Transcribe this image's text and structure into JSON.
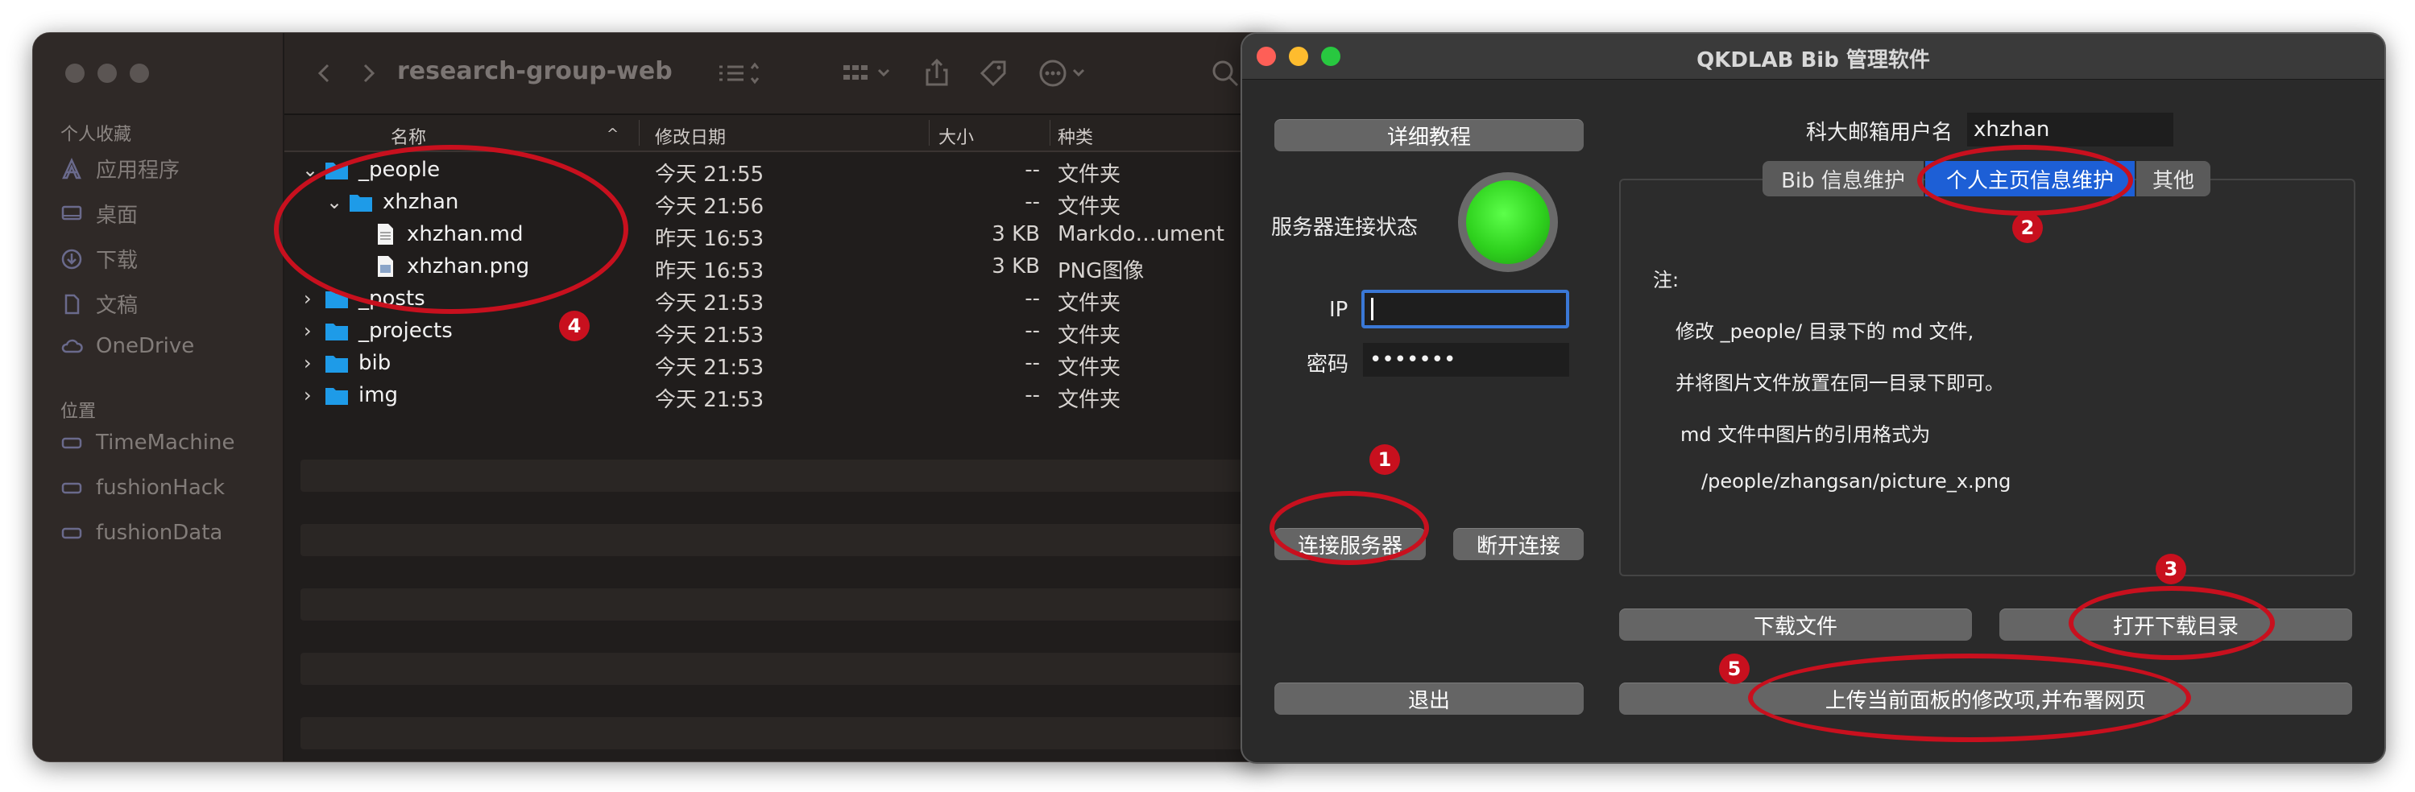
{
  "finder": {
    "title": "research-group-web",
    "sidebar": {
      "favorites_heading": "个人收藏",
      "favorites": [
        {
          "label": "应用程序",
          "icon": "applications-icon"
        },
        {
          "label": "桌面",
          "icon": "desktop-icon"
        },
        {
          "label": "下载",
          "icon": "downloads-icon"
        },
        {
          "label": "文稿",
          "icon": "documents-icon"
        },
        {
          "label": "OneDrive",
          "icon": "cloud-icon"
        }
      ],
      "locations_heading": "位置",
      "locations": [
        {
          "label": "TimeMachine",
          "icon": "disk-icon"
        },
        {
          "label": "fushionHack",
          "icon": "disk-icon"
        },
        {
          "label": "fushionData",
          "icon": "disk-icon"
        }
      ]
    },
    "columns": {
      "name": "名称",
      "modified": "修改日期",
      "size": "大小",
      "kind": "种类"
    },
    "rows": [
      {
        "name": "_people",
        "date": "今天 21:55",
        "size": "--",
        "kind": "文件夹",
        "type": "folder",
        "indent": 0,
        "disclosure": "open"
      },
      {
        "name": "xhzhan",
        "date": "今天 21:56",
        "size": "--",
        "kind": "文件夹",
        "type": "folder",
        "indent": 1,
        "disclosure": "open"
      },
      {
        "name": "xhzhan.md",
        "date": "昨天 16:53",
        "size": "3 KB",
        "kind": "Markdo…ument",
        "type": "file",
        "indent": 2,
        "disclosure": "none"
      },
      {
        "name": "xhzhan.png",
        "date": "昨天 16:53",
        "size": "3 KB",
        "kind": "PNG图像",
        "type": "image",
        "indent": 2,
        "disclosure": "none"
      },
      {
        "name": "_posts",
        "date": "今天 21:53",
        "size": "--",
        "kind": "文件夹",
        "type": "folder",
        "indent": 0,
        "disclosure": "closed"
      },
      {
        "name": "_projects",
        "date": "今天 21:53",
        "size": "--",
        "kind": "文件夹",
        "type": "folder",
        "indent": 0,
        "disclosure": "closed"
      },
      {
        "name": "bib",
        "date": "今天 21:53",
        "size": "--",
        "kind": "文件夹",
        "type": "folder",
        "indent": 0,
        "disclosure": "closed"
      },
      {
        "name": "img",
        "date": "今天 21:53",
        "size": "--",
        "kind": "文件夹",
        "type": "folder",
        "indent": 0,
        "disclosure": "closed"
      }
    ]
  },
  "bib": {
    "title": "QKDLAB Bib 管理软件",
    "tutorial_button": "详细教程",
    "email_label": "科大邮箱用户名",
    "email_value": "xhzhan",
    "server_status_label": "服务器连接状态",
    "ip_label": "IP",
    "ip_value": "",
    "password_label": "密码",
    "password_value": "•••••••",
    "connect_button": "连接服务器",
    "disconnect_button": "断开连接",
    "exit_button": "退出",
    "tabs": [
      "Bib 信息维护",
      "个人主页信息维护",
      "其他"
    ],
    "active_tab": "个人主页信息维护",
    "notes": [
      "注:",
      "修改 _people/ 目录下的 md 文件,",
      "并将图片文件放置在同一目录下即可。",
      "md 文件中图片的引用格式为",
      "/people/zhangsan/picture_x.png"
    ],
    "download_button": "下载文件",
    "open_download_dir_button": "打开下载目录",
    "upload_button": "上传当前面板的修改项,并布署网页"
  },
  "annotations": [
    "1",
    "2",
    "3",
    "4",
    "5"
  ],
  "colors": {
    "annotation": "#c8101e",
    "status_led": "#2fd21e",
    "active_tab": "#1d5fd6",
    "folder": "#1e9be8"
  }
}
